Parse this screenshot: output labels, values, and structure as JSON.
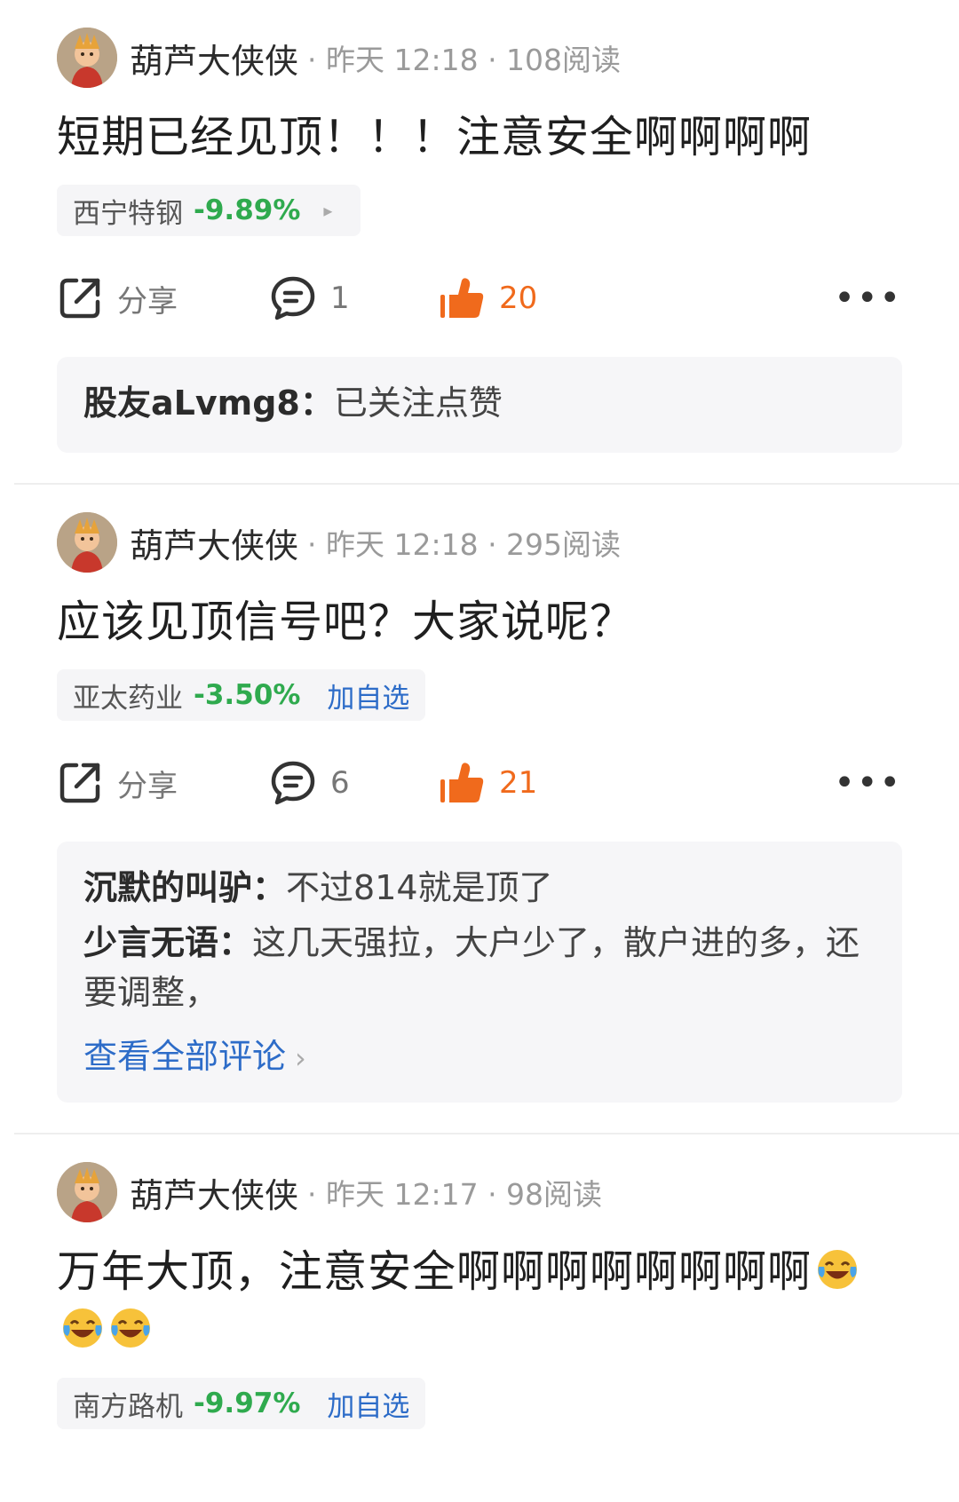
{
  "posts": [
    {
      "author": "葫芦大侠侠",
      "meta": "· 昨天 12:18 · 108阅读",
      "content": "短期已经见顶！！！注意安全啊啊啊啊",
      "stock": {
        "name": "西宁特钢",
        "change": "-9.89%",
        "trailing": "▸"
      },
      "actions": {
        "share": "分享",
        "comments": "1",
        "likes": "20",
        "more": "•••"
      },
      "comments": [
        {
          "author": "股友aLvmg8：",
          "text": "已关注点赞"
        }
      ]
    },
    {
      "author": "葫芦大侠侠",
      "meta": "· 昨天 12:18 · 295阅读",
      "content": "应该见顶信号吧？大家说呢？",
      "stock": {
        "name": "亚太药业",
        "change": "-3.50%",
        "trailing": "加自选"
      },
      "actions": {
        "share": "分享",
        "comments": "6",
        "likes": "21",
        "more": "•••"
      },
      "comments": [
        {
          "author": "沉默的叫驴：",
          "text": "不过814就是顶了"
        },
        {
          "author": "少言无语：",
          "text": "这几天强拉，大户少了，散户进的多，还要调整，"
        }
      ],
      "view_all": "查看全部评论",
      "view_all_chevron": "›"
    },
    {
      "author": "葫芦大侠侠",
      "meta": "· 昨天 12:17 · 98阅读",
      "content": "万年大顶，注意安全啊啊啊啊啊啊啊啊",
      "content_emoji_count": 3,
      "stock": {
        "name": "南方路机",
        "change": "-9.97%",
        "trailing": "加自选"
      }
    }
  ],
  "colors": {
    "negative_change": "#2faa4e",
    "like_orange": "#f06a1c",
    "link_blue": "#2d6cc8",
    "meta_gray": "#9a9a9a",
    "panel_bg": "#f6f6f8"
  },
  "icons": {
    "share": "share-icon",
    "comment": "comment-bubble-icon",
    "like": "thumbs-up-icon",
    "more": "more-dots-icon",
    "emoji": "laugh-cry-emoji-icon"
  }
}
